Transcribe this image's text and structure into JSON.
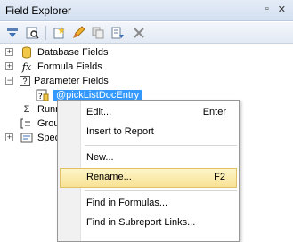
{
  "title": "Field Explorer",
  "title_buttons": [
    "pin-icon",
    "close-icon"
  ],
  "toolbar": [
    "insert-to-report-icon",
    "browse-field-icon",
    "new-field-icon",
    "edit-pencil-icon",
    "duplicate-icon",
    "rename-icon",
    "delete-x-icon"
  ],
  "tree": {
    "database_fields": "Database Fields",
    "formula_fields": "Formula Fields",
    "parameter_fields": "Parameter Fields",
    "param_child": "@pickListDocEntry",
    "running_total": "Runn",
    "group_name": "Grou",
    "special": "Spec"
  },
  "menu": {
    "edit": "Edit...",
    "edit_key": "Enter",
    "insert": "Insert to Report",
    "new": "New...",
    "rename": "Rename...",
    "rename_key": "F2",
    "find_formulas": "Find in Formulas...",
    "find_subreport": "Find in Subreport Links..."
  },
  "colors": {
    "selection": "#3399ff",
    "menu_hover": "#fbe9a8"
  }
}
